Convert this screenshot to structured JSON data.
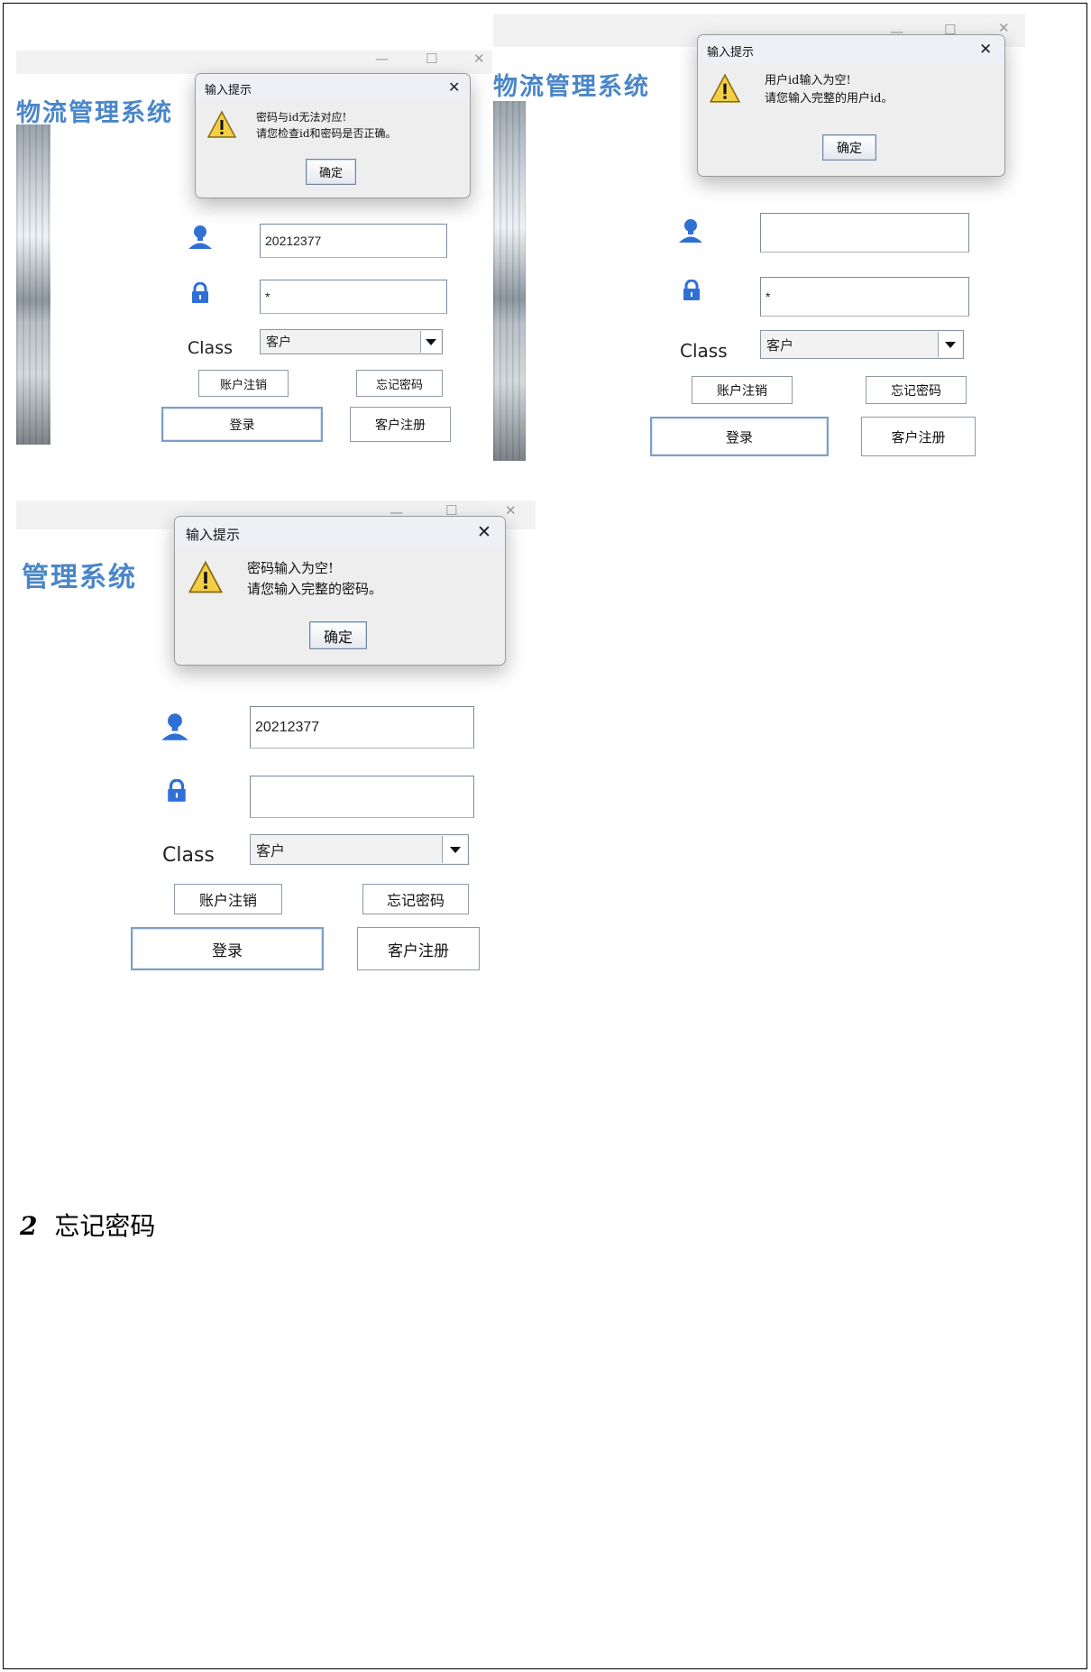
{
  "screenshots": [
    {
      "window_controls": {
        "minimize": "—",
        "maximize": "☐",
        "close": "✕"
      },
      "app_title": "物流管理系统",
      "user_id_value": "20212377",
      "password_value": "*",
      "class_label": "Class",
      "class_selected": "客户",
      "buttons": {
        "deregister": "账户注销",
        "forgot_password": "忘记密码",
        "login": "登录",
        "register": "客户注册"
      },
      "dialog": {
        "title": "输入提示",
        "close": "✕",
        "line1": "密码与id无法对应!",
        "line2": "请您检查id和密码是否正确。",
        "ok": "确定"
      }
    },
    {
      "window_controls": {
        "minimize": "—",
        "maximize": "☐",
        "close": "✕"
      },
      "app_title": "物流管理系统",
      "user_id_value": "",
      "password_value": "*",
      "class_label": "Class",
      "class_selected": "客户",
      "buttons": {
        "deregister": "账户注销",
        "forgot_password": "忘记密码",
        "login": "登录",
        "register": "客户注册"
      },
      "dialog": {
        "title": "输入提示",
        "close": "✕",
        "line1": "用户id输入为空!",
        "line2": "请您输入完整的用户id。",
        "ok": "确定"
      }
    },
    {
      "window_controls": {
        "minimize": "—",
        "maximize": "☐",
        "close": "✕"
      },
      "app_title": "管理系统",
      "user_id_value": "20212377",
      "password_value": "",
      "class_label": "Class",
      "class_selected": "客户",
      "buttons": {
        "deregister": "账户注销",
        "forgot_password": "忘记密码",
        "login": "登录",
        "register": "客户注册"
      },
      "dialog": {
        "title": "输入提示",
        "close": "✕",
        "line1": "密码输入为空!",
        "line2": "请您输入完整的密码。",
        "ok": "确定"
      }
    }
  ],
  "section": {
    "number": "2",
    "title": "忘记密码"
  },
  "icons": {
    "user": "user-icon",
    "lock": "lock-icon",
    "warning": "warning-icon",
    "dropdown": "chevron-down-icon"
  },
  "colors": {
    "app_title": "#4a86c8",
    "icon_blue": "#2f6fd6",
    "warning_yellow": "#f3cf45"
  }
}
